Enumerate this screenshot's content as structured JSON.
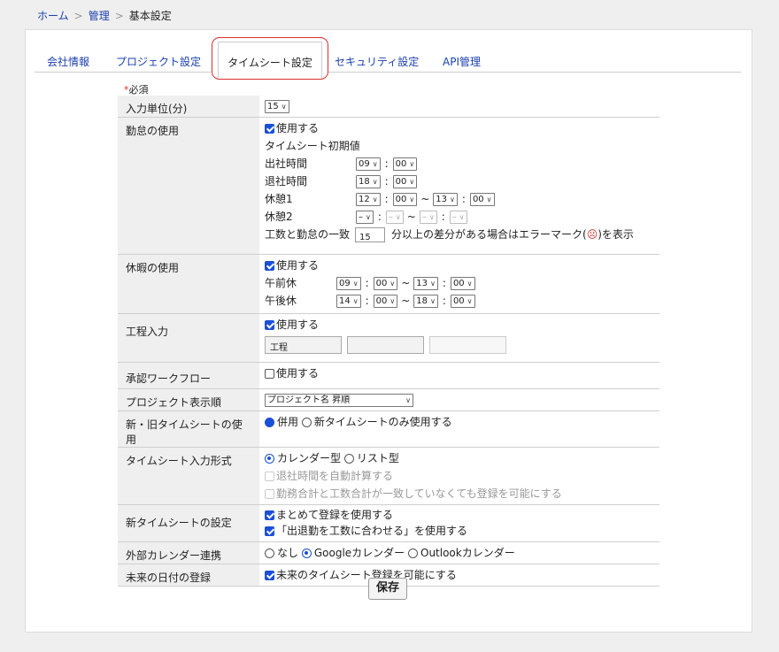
{
  "breadcrumb": {
    "home": "ホーム",
    "sep": ">",
    "admin": "管理",
    "current": "基本設定"
  },
  "tabs": {
    "company": "会社情報",
    "project": "プロジェクト設定",
    "timesheet": "タイムシート設定",
    "security": "セキュリティ設定",
    "api": "API管理"
  },
  "required_note": {
    "star": "*",
    "text": "必須"
  },
  "rows": {
    "input_unit": {
      "label": "入力単位(分)",
      "value": "15"
    },
    "attendance": {
      "label": "勤怠の使用",
      "use": "使用する",
      "defaults_heading": "タイムシート初期値",
      "clock_in": {
        "label": "出社時間",
        "hour": "09",
        "minute": "00"
      },
      "clock_out": {
        "label": "退社時間",
        "hour": "18",
        "minute": "00"
      },
      "break1": {
        "label": "休憩1",
        "from_hour": "12",
        "from_minute": "00",
        "to_hour": "13",
        "to_minute": "00"
      },
      "break2": {
        "label": "休憩2",
        "from_hour": "–",
        "from_minute": "–",
        "to_hour": "–",
        "to_minute": "–"
      },
      "match_prefix": "工数と勤怠の一致",
      "match_minutes": "15",
      "match_suffix_before": "分以上の差分がある場合はエラーマーク(",
      "match_suffix_after": ")を表示"
    },
    "leave": {
      "label": "休暇の使用",
      "use": "使用する",
      "am": {
        "label": "午前休",
        "from_hour": "09",
        "from_minute": "00",
        "to_hour": "13",
        "to_minute": "00"
      },
      "pm": {
        "label": "午後休",
        "from_hour": "14",
        "from_minute": "00",
        "to_hour": "18",
        "to_minute": "00"
      }
    },
    "process": {
      "label": "工程入力",
      "use": "使用する",
      "field1": "工程",
      "field2": "",
      "field3": ""
    },
    "approval": {
      "label": "承認ワークフロー",
      "use": "使用する"
    },
    "project_order": {
      "label": "プロジェクト表示順",
      "value": "プロジェクト名 昇順"
    },
    "old_new": {
      "label": "新・旧タイムシートの使用",
      "opt1": "併用",
      "opt2": "新タイムシートのみ使用する"
    },
    "input_format": {
      "label": "タイムシート入力形式",
      "opt1": "カレンダー型",
      "opt2": "リスト型",
      "auto_calc": "退社時間を自動計算する",
      "allow_mismatch": "勤務合計と工数合計が一致していなくても登録を可能にする"
    },
    "new_settings": {
      "label": "新タイムシートの設定",
      "bulk": "まとめて登録を使用する",
      "match_work": "「出退勤を工数に合わせる」を使用する"
    },
    "calendar": {
      "label": "外部カレンダー連携",
      "none": "なし",
      "google": "Googleカレンダー",
      "outlook": "Outlookカレンダー"
    },
    "future": {
      "label": "未来の日付の登録",
      "use": "未来のタイムシート登録を可能にする"
    }
  },
  "save_label": "保存",
  "icons": {
    "dropdown": "chevron-down-icon",
    "error": "error-face-icon"
  },
  "colors": {
    "accent": "#1a4fd8",
    "link": "#1a3fb0",
    "tab_highlight": "#d9302c"
  }
}
